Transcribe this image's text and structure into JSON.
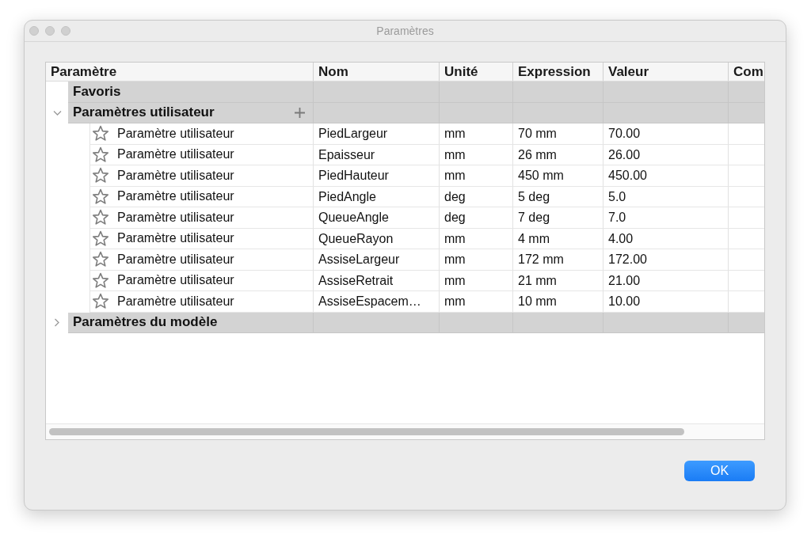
{
  "window": {
    "title": "Paramètres"
  },
  "table": {
    "columns": [
      "Paramètre",
      "Nom",
      "Unité",
      "Expression",
      "Valeur",
      "Com"
    ],
    "groups": [
      {
        "label": "Favoris",
        "expandable": false,
        "add_button": false
      },
      {
        "label": "Paramètres utilisateur",
        "expandable": true,
        "expanded": true,
        "add_button": true,
        "rows": [
          {
            "favorite": false,
            "cells": [
              "Paramètre utilisateur",
              "PiedLargeur",
              "mm",
              "70 mm",
              "70.00"
            ]
          },
          {
            "favorite": false,
            "cells": [
              "Paramètre utilisateur",
              "Epaisseur",
              "mm",
              "26 mm",
              "26.00"
            ]
          },
          {
            "favorite": false,
            "cells": [
              "Paramètre utilisateur",
              "PiedHauteur",
              "mm",
              "450 mm",
              "450.00"
            ]
          },
          {
            "favorite": false,
            "cells": [
              "Paramètre utilisateur",
              "PiedAngle",
              "deg",
              "5 deg",
              "5.0"
            ]
          },
          {
            "favorite": false,
            "cells": [
              "Paramètre utilisateur",
              "QueueAngle",
              "deg",
              "7 deg",
              "7.0"
            ]
          },
          {
            "favorite": false,
            "cells": [
              "Paramètre utilisateur",
              "QueueRayon",
              "mm",
              "4 mm",
              "4.00"
            ]
          },
          {
            "favorite": false,
            "cells": [
              "Paramètre utilisateur",
              "AssiseLargeur",
              "mm",
              "172 mm",
              "172.00"
            ]
          },
          {
            "favorite": false,
            "cells": [
              "Paramètre utilisateur",
              "AssiseRetrait",
              "mm",
              "21 mm",
              "21.00"
            ]
          },
          {
            "favorite": false,
            "cells": [
              "Paramètre utilisateur",
              "AssiseEspacem…",
              "mm",
              "10 mm",
              "10.00"
            ]
          }
        ]
      },
      {
        "label": "Paramètres du modèle",
        "expandable": true,
        "expanded": false,
        "add_button": false
      }
    ]
  },
  "buttons": [
    {
      "label": "OK",
      "default": true
    }
  ]
}
